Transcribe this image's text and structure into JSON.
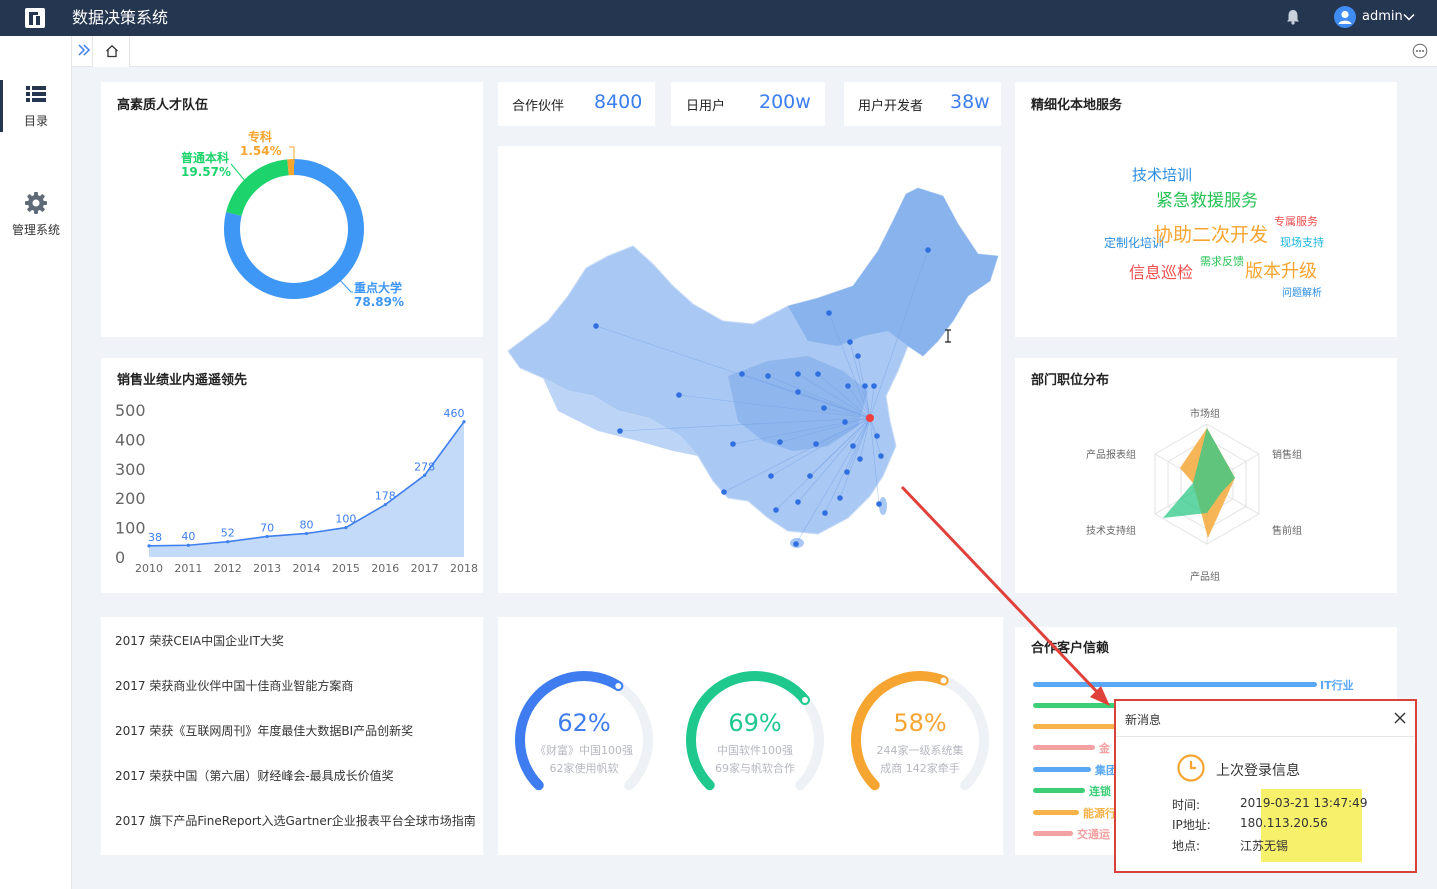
{
  "app": {
    "title": "数据决策系统",
    "username": "admin"
  },
  "sidebar": {
    "items": [
      {
        "label": "目录"
      },
      {
        "label": "管理系统"
      }
    ]
  },
  "kpis": [
    {
      "label": "合作伙伴",
      "value": "8400"
    },
    {
      "label": "日用户",
      "value": "200w"
    },
    {
      "label": "用户开发者",
      "value": "38w"
    }
  ],
  "talent": {
    "title": "高素质人才队伍",
    "slices": [
      {
        "name": "重点大学",
        "pct": "78.89%",
        "value": 78.89,
        "color": "#3f97f5"
      },
      {
        "name": "普通本科",
        "pct": "19.57%",
        "value": 19.57,
        "color": "#1dd36b"
      },
      {
        "name": "专科",
        "pct": "1.54%",
        "value": 1.54,
        "color": "#f7a531"
      }
    ]
  },
  "chart_data": {
    "type": "area",
    "title": "销售业绩业内遥遥领先",
    "categories": [
      "2010",
      "2011",
      "2012",
      "2013",
      "2014",
      "2015",
      "2016",
      "2017",
      "2018"
    ],
    "values": [
      38,
      40,
      52,
      70,
      80,
      100,
      178,
      278,
      460
    ],
    "yticks": [
      "500",
      "400",
      "300",
      "200",
      "100",
      "0"
    ],
    "ylim": [
      0,
      500
    ],
    "color": "#3f7fee"
  },
  "services": {
    "title": "精细化本地服务",
    "words": [
      {
        "text": "技术培训",
        "color": "#2b8de0"
      },
      {
        "text": "紧急救援服务",
        "color": "#27c256"
      },
      {
        "text": "专属服务",
        "color": "#ef4f4f"
      },
      {
        "text": "定制化培训",
        "color": "#2b8de0"
      },
      {
        "text": "协助二次开发",
        "color": "#f7a531"
      },
      {
        "text": "现场支持",
        "color": "#16b4e0"
      },
      {
        "text": "需求反馈",
        "color": "#27c256"
      },
      {
        "text": "信息巡检",
        "color": "#ef4f4f"
      },
      {
        "text": "版本升级",
        "color": "#f7a531"
      },
      {
        "text": "问题解析",
        "color": "#2b8de0"
      }
    ]
  },
  "departments": {
    "title": "部门职位分布",
    "axes": [
      "市场组",
      "销售组",
      "售前组",
      "产品组",
      "技术支持组",
      "产品报表组"
    ]
  },
  "awards": [
    "2017 荣获CEIA中国企业IT大奖",
    "2017 荣获商业伙伴中国十佳商业智能方案商",
    "2017 荣获《互联网周刊》年度最佳大数据BI产品创新奖",
    "2017 荣获中国（第六届）财经峰会-最具成长价值奖",
    "2017 旗下产品FineReport入选Gartner企业报表平台全球市场指南"
  ],
  "gauges": [
    {
      "pct": "62%",
      "value": 62,
      "line1": "《财富》中国100强",
      "line2": "62家使用帆软",
      "color": "#3f7cf0"
    },
    {
      "pct": "69%",
      "value": 69,
      "line1": "中国软件100强",
      "line2": "69家与帆软合作",
      "color": "#1fc98e"
    },
    {
      "pct": "58%",
      "value": 58,
      "line1": "244家一级系统集",
      "line2": "成商 142家牵手",
      "color": "#f7a531"
    }
  ],
  "trust": {
    "title": "合作客户信赖",
    "bars": [
      {
        "label": "IT行业",
        "color": "#5aa8f5"
      },
      {
        "label": "",
        "color": "#3ccf78"
      },
      {
        "label": "",
        "color": "#f7b24a"
      },
      {
        "label": "金",
        "color": "#f3a1a1"
      },
      {
        "label": "集团",
        "color": "#5aa8f5"
      },
      {
        "label": "连锁",
        "color": "#3ccf78"
      },
      {
        "label": "能源行",
        "color": "#f7b24a"
      },
      {
        "label": "交通运",
        "color": "#f3a1a1"
      }
    ]
  },
  "popup": {
    "title": "新消息",
    "subtitle": "上次登录信息",
    "time_label": "时间:",
    "time": "2019-03-21 13:47:49",
    "ip_label": "IP地址:",
    "ip": "180.113.20.56",
    "loc_label": "地点:",
    "loc": "江苏无锡"
  }
}
